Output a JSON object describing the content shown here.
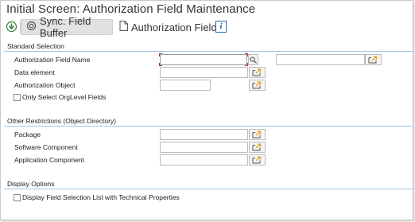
{
  "window": {
    "title": "Initial Screen: Authorization Field Maintenance"
  },
  "toolbar": {
    "execute_icon": "execute-icon",
    "sync_label": "Sync. Field Buffer",
    "sync_icon": "sync-icon",
    "auth_field_label": "Authorization Field",
    "auth_field_icon": "document-icon",
    "info_icon": "info-icon",
    "info_glyph": "i"
  },
  "standard_selection": {
    "title": "Standard Selection",
    "fields": [
      {
        "label": "Authorization Field Name",
        "value": "",
        "to_value": ""
      },
      {
        "label": "Data element",
        "value": ""
      },
      {
        "label": "Authorization Object",
        "value": ""
      }
    ],
    "orglevel_checkbox": {
      "label": "Only Select OrgLevel Fields",
      "checked": false
    }
  },
  "other_restrictions": {
    "title": "Other Restrictions (Object Directory)",
    "fields": [
      {
        "label": "Package",
        "value": ""
      },
      {
        "label": "Software Component",
        "value": ""
      },
      {
        "label": "Application Component",
        "value": ""
      }
    ]
  },
  "display_options": {
    "title": "Display Options",
    "tech_props_checkbox": {
      "label": "Display Field Selection List with Technical Properties",
      "checked": false
    }
  },
  "colors": {
    "group_line": "#9dc3e6",
    "info_accent": "#1f5fa8",
    "multi_select_arrow": "#e8a020"
  }
}
